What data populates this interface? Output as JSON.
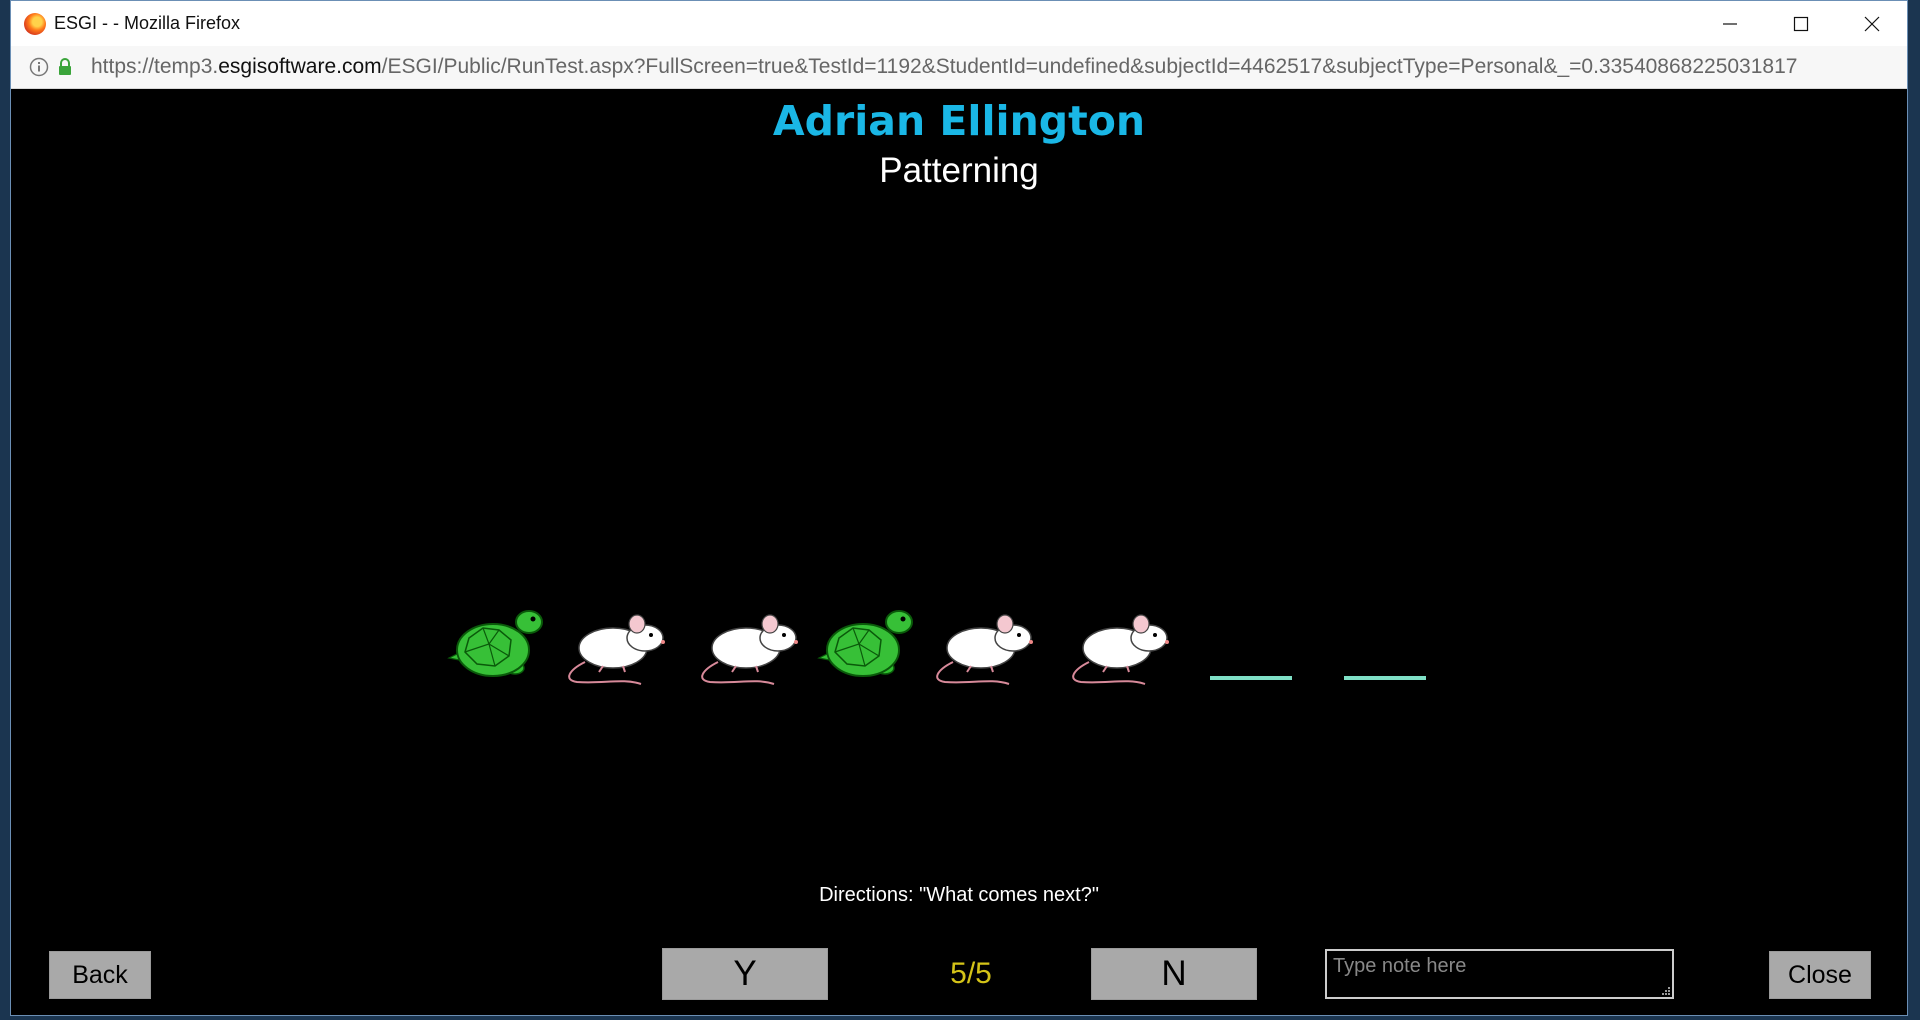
{
  "window": {
    "title": "ESGI - - Mozilla Firefox",
    "url_prefix": "https://temp3.",
    "url_domain": "esgisoftware.com",
    "url_path": "/ESGI/Public/RunTest.aspx?FullScreen=true&TestId=1192&StudentId=undefined&subjectId=4462517&subjectType=Personal&_=0.33540868225031817"
  },
  "test": {
    "student_name": "Adrian Ellington",
    "test_name": "Patterning",
    "directions": "Directions: \"What comes next?\"",
    "progress": "5/5"
  },
  "pattern": {
    "items": [
      "turtle",
      "mouse",
      "mouse",
      "turtle",
      "mouse",
      "mouse"
    ],
    "blank_slots": 2
  },
  "controls": {
    "back_label": "Back",
    "yes_label": "Y",
    "no_label": "N",
    "close_label": "Close",
    "note_placeholder": "Type note here"
  },
  "colors": {
    "student_name": "#1ab7e6",
    "counter": "#d4c318",
    "slot_line": "#7fe0c6"
  }
}
